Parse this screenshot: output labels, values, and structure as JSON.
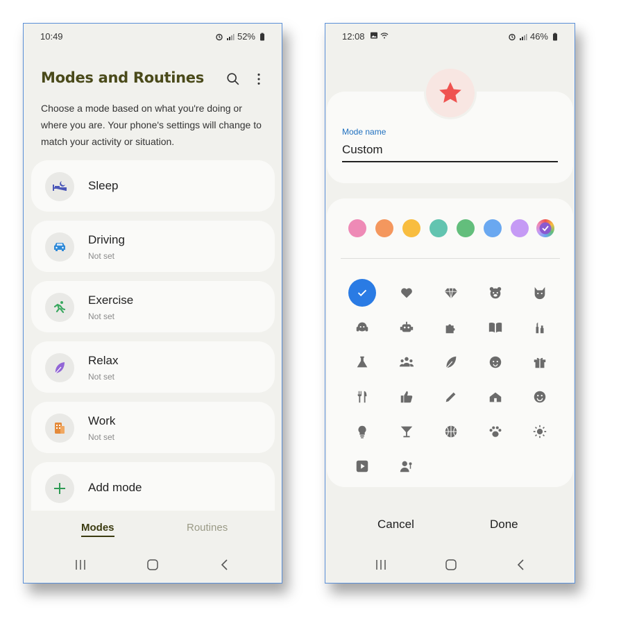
{
  "left_screen": {
    "status": {
      "time": "10:49",
      "battery": "52%"
    },
    "title": "Modes and Routines",
    "description": "Choose a mode based on what you're doing or where you are. Your phone's settings will change to match your activity or situation.",
    "modes": [
      {
        "name": "Sleep",
        "status": "",
        "icon": "sleep-bed-icon",
        "color": "#4b57b8"
      },
      {
        "name": "Driving",
        "status": "Not set",
        "icon": "car-icon",
        "color": "#2f8ad8"
      },
      {
        "name": "Exercise",
        "status": "Not set",
        "icon": "running-icon",
        "color": "#3aa860"
      },
      {
        "name": "Relax",
        "status": "Not set",
        "icon": "leaf-icon",
        "color": "#9266d6"
      },
      {
        "name": "Work",
        "status": "Not set",
        "icon": "building-icon",
        "color": "#e48a3a"
      },
      {
        "name": "Add mode",
        "status": "",
        "icon": "plus-icon",
        "color": "#2e9a54"
      }
    ],
    "tabs": {
      "modes": "Modes",
      "routines": "Routines"
    }
  },
  "right_screen": {
    "status": {
      "time": "12:08",
      "battery": "46%"
    },
    "selected_icon": "star-icon",
    "selected_color": "#ef5350",
    "mode_name_label": "Mode name",
    "mode_name_value": "Custom",
    "colors": [
      "#ee8ab6",
      "#f4975e",
      "#f8bd3f",
      "#62c4b0",
      "#63be7c",
      "#6aa8f0",
      "#c59af5",
      "multicolor"
    ],
    "icons": [
      "check-icon",
      "heart-icon",
      "diamond-icon",
      "bear-icon",
      "cat-icon",
      "headphones-icon",
      "robot-icon",
      "puzzle-icon",
      "book-icon",
      "lipstick-icon",
      "flask-icon",
      "people-icon",
      "leaf-icon",
      "baby-icon",
      "gift-icon",
      "fork-knife-icon",
      "thumbs-up-icon",
      "pencil-icon",
      "house-icon",
      "smile-icon",
      "lightbulb-icon",
      "cocktail-icon",
      "basketball-icon",
      "paw-icon",
      "sun-icon",
      "play-icon",
      "person-speak-icon"
    ],
    "cancel_label": "Cancel",
    "done_label": "Done"
  }
}
